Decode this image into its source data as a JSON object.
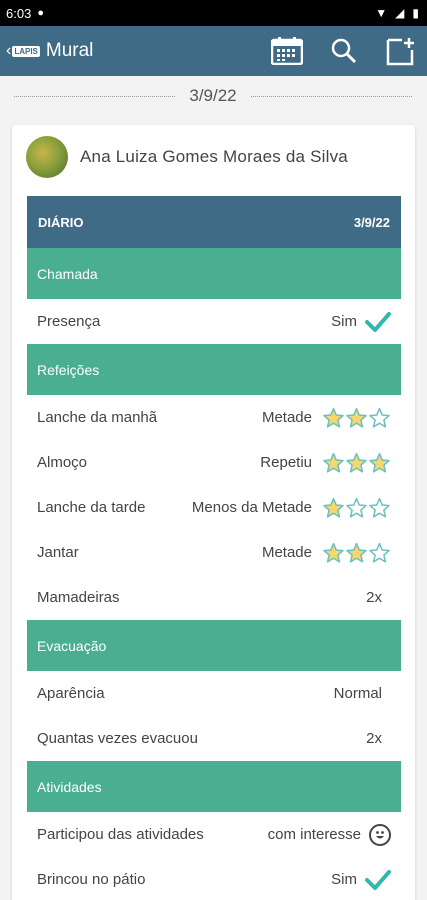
{
  "status_bar": {
    "time": "6:03"
  },
  "app_bar": {
    "logo": "LAPIS",
    "title": "Mural"
  },
  "feed": {
    "date": "3/9/22"
  },
  "student": {
    "name": "Ana Luiza Gomes Moraes da Silva"
  },
  "diary": {
    "header_label": "DIÁRIO",
    "header_date": "3/9/22",
    "sections": {
      "chamada": "Chamada",
      "refeicoes": "Refeições",
      "evacuacao": "Evacuação",
      "atividades": "Atividades"
    },
    "rows": {
      "presenca": {
        "label": "Presença",
        "value": "Sim"
      },
      "lanche_manha": {
        "label": "Lanche da manhã",
        "value": "Metade",
        "rating": 2
      },
      "almoco": {
        "label": "Almoço",
        "value": "Repetiu",
        "rating": 3
      },
      "lanche_tarde": {
        "label": "Lanche da tarde",
        "value": "Menos da Metade",
        "rating": 1
      },
      "jantar": {
        "label": "Jantar",
        "value": "Metade",
        "rating": 2
      },
      "mamadeiras": {
        "label": "Mamadeiras",
        "value": "2x"
      },
      "aparencia": {
        "label": "Aparência",
        "value": "Normal"
      },
      "quantas_vezes": {
        "label": "Quantas vezes evacuou",
        "value": "2x"
      },
      "participou": {
        "label": "Participou das atividades",
        "value": "com interesse"
      },
      "brincou": {
        "label": "Brincou no pátio",
        "value": "Sim"
      }
    }
  },
  "colors": {
    "primary": "#3f6b86",
    "section": "#4aaf91",
    "star_fill": "#f5d76e",
    "star_outline": "#6cc0c0",
    "check": "#2fb8b0"
  }
}
